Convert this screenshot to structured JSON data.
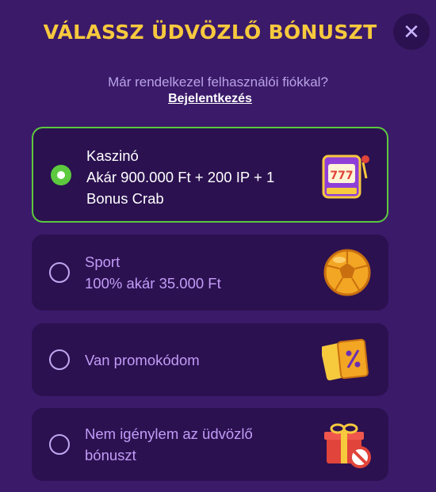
{
  "header": {
    "title": "VÁLASSZ ÜDVÖZLŐ BÓNUSZT",
    "close_label": "✕"
  },
  "login": {
    "prompt": "Már rendelkezel felhasználói fiókkal?",
    "link": "Bejelentkezés"
  },
  "options": [
    {
      "title": "Kaszinó",
      "line1": "Akár 900.000 Ft + 200 IP + 1",
      "line2": "Bonus Crab",
      "icon": "slot-machine-icon",
      "selected": true
    },
    {
      "title": "Sport",
      "line1": "100% akár 35.000 Ft",
      "icon": "soccer-ball-icon",
      "selected": false
    },
    {
      "title": "Van promokódom",
      "icon": "promo-ticket-icon",
      "selected": false
    },
    {
      "title": "Nem igénylem az üdvözlő",
      "line1": "bónuszt",
      "icon": "gift-no-icon",
      "selected": false
    }
  ],
  "slot_text": "777",
  "colors": {
    "accent": "#f7c93d",
    "selected_border": "#5cc93e",
    "card_bg": "#2b1150",
    "page_bg": "#3b1a6a"
  }
}
